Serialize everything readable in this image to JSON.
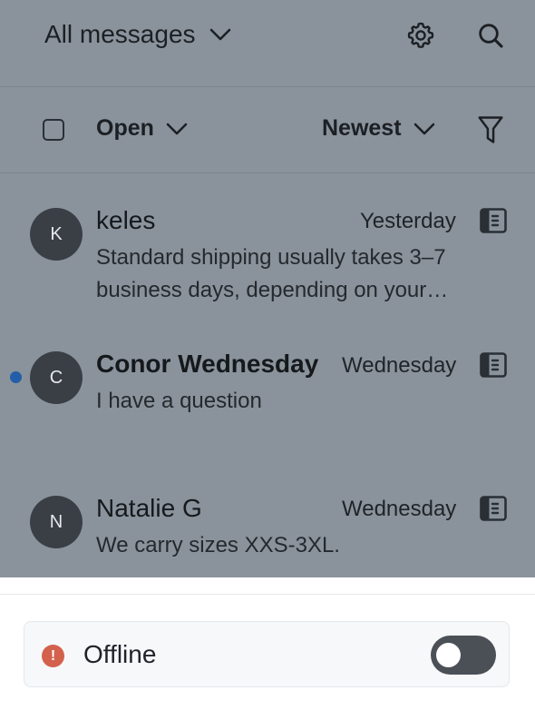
{
  "header": {
    "view_title": "All messages"
  },
  "filters": {
    "status": "Open",
    "sort": "Newest"
  },
  "conversations": [
    {
      "initial": "K",
      "name": "keles",
      "time": "Yesterday",
      "preview": "Standard shipping usually takes 3–7 business days, depending on your…",
      "unread": false
    },
    {
      "initial": "C",
      "name": "Conor Wednesday",
      "time": "Wednesday",
      "preview": "I have a question",
      "unread": true
    },
    {
      "initial": "N",
      "name": "Natalie G",
      "time": "Wednesday",
      "preview": "We carry sizes XXS-3XL.",
      "unread": false
    }
  ],
  "availability": {
    "label": "Offline",
    "online": false
  },
  "colors": {
    "overlay": "#8a939c",
    "unread_dot": "#245ea8",
    "offline_icon": "#d3614c",
    "toggle_off": "#4b5057"
  },
  "icons": {
    "settings": "gear-icon",
    "search": "search-icon",
    "filter": "filter-icon",
    "channel": "channel-panel-icon",
    "dropdown": "chevron-down-icon",
    "offline": "exclamation-icon"
  }
}
